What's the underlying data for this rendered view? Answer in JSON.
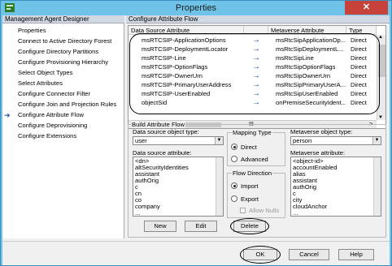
{
  "window": {
    "title": "Properties",
    "close_label": "✕"
  },
  "left_pane": {
    "header": "Management Agent Designer",
    "items": [
      "Properties",
      "Connect to Active Directory Forest",
      "Configure Directory Partitions",
      "Configure Provisioning Hierarchy",
      "Select Object Types",
      "Select Attributes",
      "Configure Connector Filter",
      "Configure Join and Projection Rules",
      "Configure Attribute Flow",
      "Configure Deprovisioning",
      "Configure Extensions"
    ],
    "selected_index": 8
  },
  "right_pane": {
    "header": "Configure Attribute Flow",
    "grid": {
      "columns": [
        "Data Source Attribute",
        "",
        "Metaverse Attribute",
        "Type"
      ],
      "rows": [
        [
          "msRTCSIP-ApplicationOptions",
          "→",
          "msRtcSipApplicationOp...",
          "Direct"
        ],
        [
          "msRTCSIP-DeploymentLocator",
          "→",
          "msRtcSipDeploymentL...",
          "Direct"
        ],
        [
          "msRTCSIP-Line",
          "→",
          "msRtcSipLine",
          "Direct"
        ],
        [
          "msRTCSIP-OptionFlags",
          "→",
          "msRtcSipOptionFlags",
          "Direct"
        ],
        [
          "msRTCSIP-OwnerUrn",
          "→",
          "msRtcSipOwnerUrn",
          "Direct"
        ],
        [
          "msRTCSIP-PrimaryUserAddress",
          "→",
          "msRtcSipPrimaryUserA...",
          "Direct"
        ],
        [
          "msRTCSIP-UserEnabled",
          "→",
          "msRtcSipUserEnabled",
          "Direct"
        ],
        [
          "objectSid",
          "→",
          "onPremiseSecurityIdent...",
          "Direct"
        ]
      ],
      "scroll_glyphs": {
        "left": "<",
        "mid": "III",
        "right": ">",
        "up": "▲",
        "down": "▼"
      }
    },
    "build": {
      "group_label": "Build Attribute Flow",
      "ds_object_type_label": "Data source object type:",
      "ds_object_type_value": "user",
      "mapping_type_label": "Mapping Type",
      "direct_label": "Direct",
      "advanced_label": "Advanced",
      "mv_object_type_label": "Metaverse object type:",
      "mv_object_type_value": "person",
      "ds_attribute_label": "Data source attribute:",
      "ds_attributes": [
        "<dn>",
        "altSecurityIdentities",
        "assistant",
        "authOrig",
        "c",
        "cn",
        "co",
        "company",
        "..."
      ],
      "flow_direction_label": "Flow Direction",
      "import_label": "Import",
      "export_label": "Export",
      "allow_nulls_label": "Allow Nulls",
      "mv_attribute_label": "Metaverse attribute:",
      "mv_attributes": [
        "<object-id>",
        "accountEnabled",
        "alias",
        "assistant",
        "authOrig",
        "c",
        "city",
        "cloudAnchor",
        "..."
      ],
      "new_label": "New",
      "edit_label": "Edit",
      "delete_label": "Delete"
    }
  },
  "footer": {
    "ok_label": "OK",
    "cancel_label": "Cancel",
    "help_label": "Help"
  }
}
